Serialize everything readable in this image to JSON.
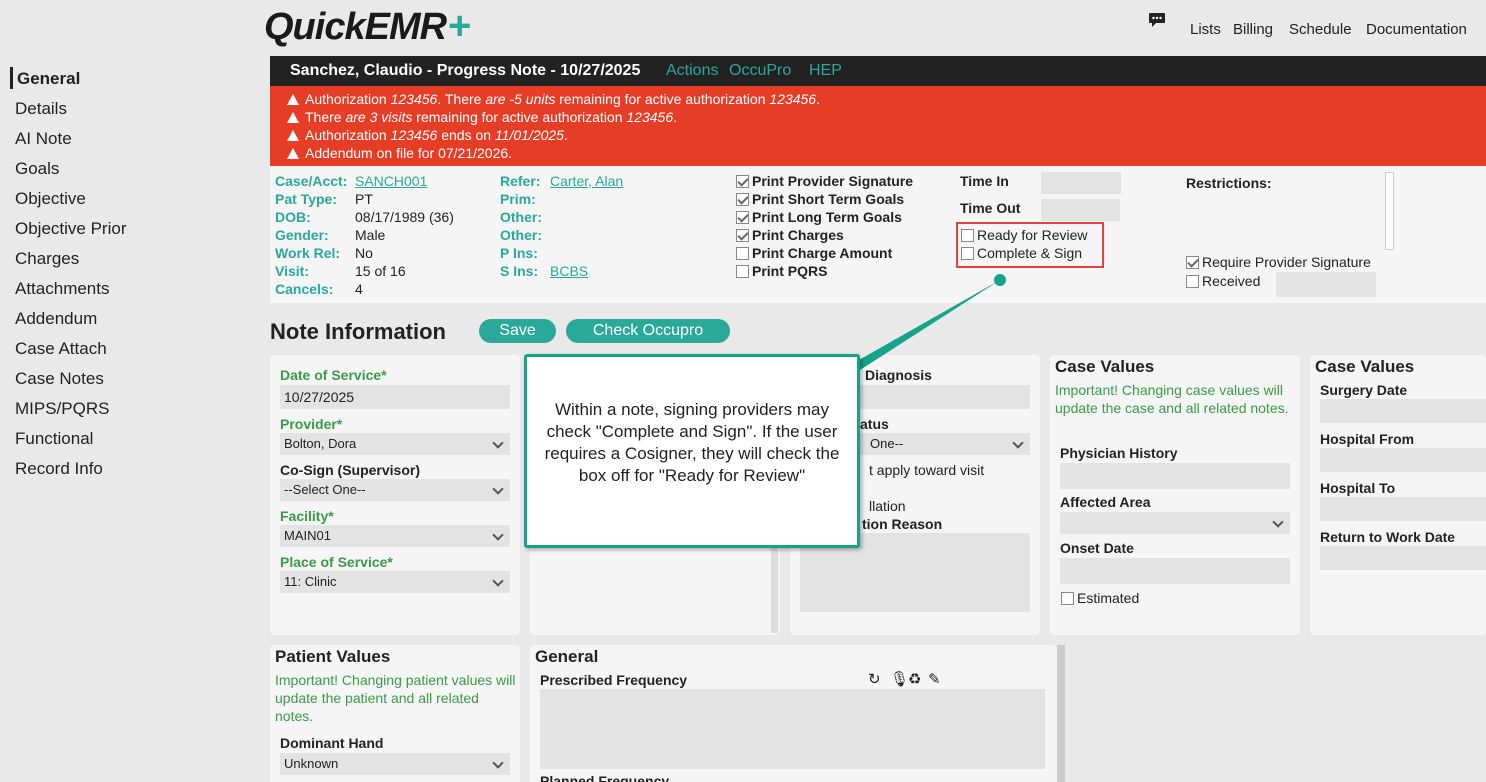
{
  "header": {
    "logo_main": "QuickEMR",
    "logo_plus": "+",
    "nav": [
      "Lists",
      "Billing",
      "Schedule",
      "Documentation"
    ]
  },
  "sidebar": {
    "items": [
      "General",
      "Details",
      "AI Note",
      "Goals",
      "Objective",
      "Objective Prior",
      "Charges",
      "Attachments",
      "Addendum",
      "Case Attach",
      "Case Notes",
      "MIPS/PQRS",
      "Functional",
      "Record Info"
    ]
  },
  "titlebar": {
    "title": "Sanchez, Claudio - Progress Note - 10/27/2025",
    "links": [
      "Actions",
      "OccuPro",
      "HEP"
    ]
  },
  "alerts": [
    {
      "pre": "Authorization ",
      "i1": "123456",
      "mid1": ". There ",
      "i2": "are -5 units",
      "mid2": " remaining for active authorization ",
      "i3": "123456",
      "post": "."
    },
    {
      "pre": "There ",
      "i1": "are 3 visits",
      "mid1": " remaining for active authorization ",
      "i2": "123456",
      "mid2": ".",
      "i3": "",
      "post": ""
    },
    {
      "pre": "Authorization ",
      "i1": "123456",
      "mid1": " ends on ",
      "i2": "11/01/2025",
      "mid2": ".",
      "i3": "",
      "post": ""
    },
    {
      "pre": "Addendum on file for 07/21/2026.",
      "i1": "",
      "mid1": "",
      "i2": "",
      "mid2": "",
      "i3": "",
      "post": ""
    }
  ],
  "info": {
    "case_label": "Case/Acct:",
    "case_value": "SANCH001",
    "pat_type_label": "Pat Type:",
    "pat_type_value": "PT",
    "dob_label": "DOB:",
    "dob_value": "08/17/1989 (36)",
    "gender_label": "Gender:",
    "gender_value": "Male",
    "work_rel_label": "Work Rel:",
    "work_rel_value": "No",
    "visit_label": "Visit:",
    "visit_value": "15 of 16",
    "cancels_label": "Cancels:",
    "cancels_value": "4",
    "refer_label": "Refer:",
    "refer_value": "Carter, Alan",
    "prim_label": "Prim:",
    "other1_label": "Other:",
    "other2_label": "Other:",
    "pins_label": "P Ins:",
    "sins_label": "S Ins:",
    "sins_value": "BCBS",
    "print_options": [
      {
        "label": "Print Provider Signature",
        "checked": true
      },
      {
        "label": "Print Short Term Goals",
        "checked": true
      },
      {
        "label": "Print Long Term Goals",
        "checked": true
      },
      {
        "label": "Print Charges",
        "checked": true
      },
      {
        "label": "Print Charge Amount",
        "checked": false
      },
      {
        "label": "Print PQRS",
        "checked": false
      }
    ],
    "time_in_label": "Time In",
    "time_out_label": "Time Out",
    "ready_review_label": "Ready for Review",
    "complete_sign_label": "Complete & Sign",
    "restrictions_label": "Restrictions:",
    "require_sig_label": "Require Provider Signature",
    "received_label": "Received"
  },
  "note": {
    "title": "Note Information",
    "save_label": "Save",
    "check_occupro_label": "Check Occupro",
    "dos_label": "Date of Service*",
    "dos_value": "10/27/2025",
    "provider_label": "Provider*",
    "provider_value": "Bolton, Dora",
    "cosign_label": "Co-Sign (Supervisor)",
    "cosign_value": "--Select One--",
    "facility_label": "Facility*",
    "facility_value": "MAIN01",
    "pos_label": "Place of Service*",
    "pos_value": "11: Clinic",
    "diag_label": "Diagnosis",
    "status_label": "atus",
    "status_value": "One--",
    "visit_apply_label": "t apply toward visit",
    "cancel_label": "llation",
    "cancel_reason_label": "tion Reason",
    "case_values_title": "Case Values",
    "case_values_important": "Important! Changing case values will update the case and all related notes.",
    "phys_history_label": "Physician History",
    "affected_area_label": "Affected Area",
    "onset_date_label": "Onset Date",
    "estimated_label": "Estimated",
    "case_values2_title": "Case Values",
    "surgery_label": "Surgery Date",
    "hosp_from_label": "Hospital From",
    "hosp_to_label": "Hospital To",
    "rtw_label": "Return to Work Date",
    "patient_values_title": "Patient Values",
    "patient_values_important": "Important! Changing patient values will update the patient and all related notes.",
    "dominant_hand_label": "Dominant Hand",
    "dominant_hand_value": "Unknown",
    "general_title": "General",
    "prescribed_freq_label": "Prescribed Frequency",
    "planned_freq_label": "Planned Frequency"
  },
  "callout": {
    "text": "Within a note, signing providers may check \"Complete and Sign\".  If the user requires a Cosigner, they will check the box off for \"Ready for Review\""
  },
  "colors": {
    "accent": "#2aa899",
    "alert": "#e63d27",
    "titlebar": "#222222",
    "callout_border": "#17a38a",
    "highlight": "#e04040"
  }
}
